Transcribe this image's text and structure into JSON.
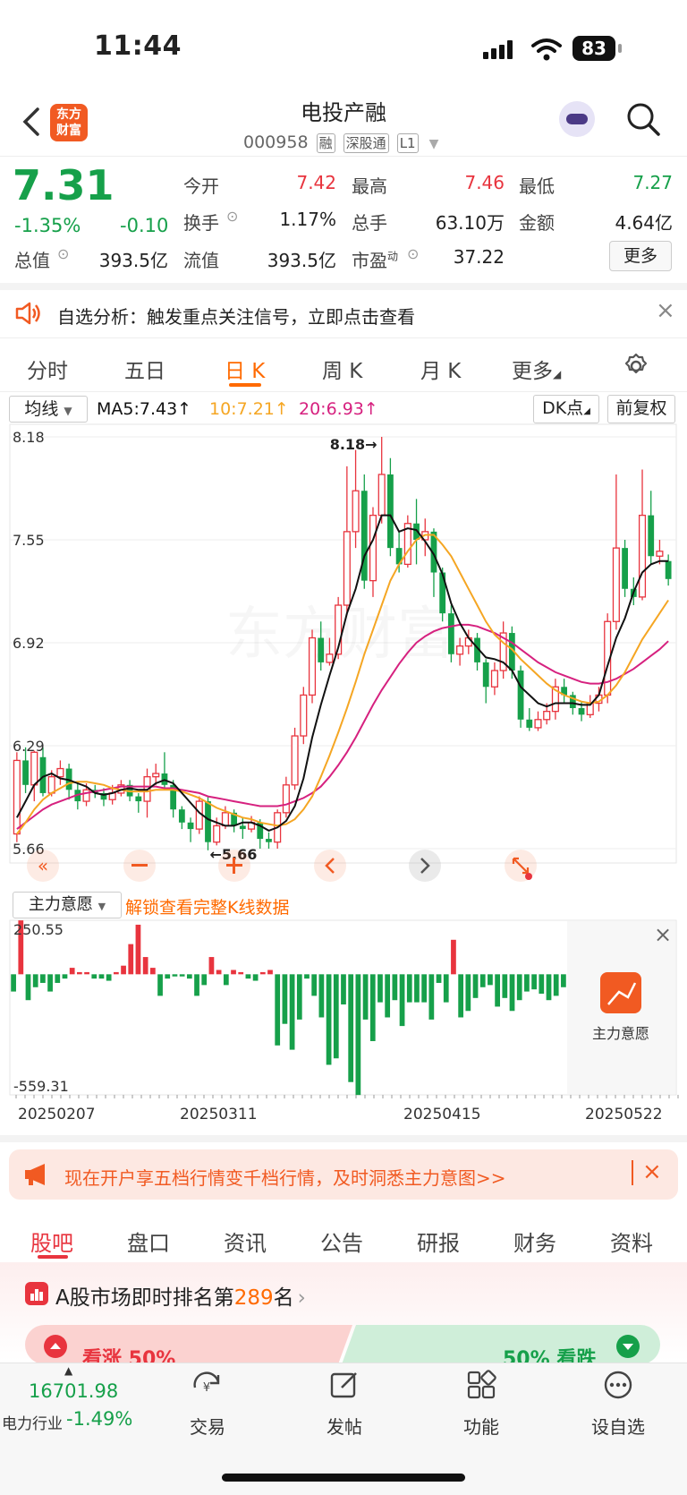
{
  "status_bar": {
    "time": "11:44",
    "battery": "83"
  },
  "header": {
    "back_icon": "chevron-left-icon",
    "logo_text_line1": "东方",
    "logo_text_line2": "财富",
    "title": "电投产融",
    "code": "000958",
    "tags": [
      "融",
      "深股通",
      "L1"
    ]
  },
  "quote": {
    "price": "7.31",
    "change_pct": "-1.35%",
    "change": "-0.10",
    "items": [
      {
        "label": "今开",
        "value": "7.42",
        "color": "red"
      },
      {
        "label": "最高",
        "value": "7.46",
        "color": "red"
      },
      {
        "label": "最低",
        "value": "7.27",
        "color": "green"
      },
      {
        "label": "换手",
        "value": "1.17%",
        "color": "dark"
      },
      {
        "label": "总手",
        "value": "63.10万",
        "color": "dark"
      },
      {
        "label": "金额",
        "value": "4.64亿",
        "color": "dark"
      },
      {
        "label": "总值",
        "value": "393.5亿",
        "color": "dark"
      },
      {
        "label": "流值",
        "value": "393.5亿",
        "color": "dark"
      },
      {
        "label": "市盈",
        "value": "37.22",
        "color": "dark"
      }
    ],
    "pe_superscript": "动",
    "more_label": "更多"
  },
  "notice": {
    "text": "自选分析：触发重点关注信号，立即点击查看"
  },
  "kline_tabs": [
    "分时",
    "五日",
    "日 K",
    "周 K",
    "月 K",
    "更多"
  ],
  "ma_bar": {
    "selector": "均线",
    "ma5": "MA5:7.43↑",
    "ma10": "10:7.21↑",
    "ma20": "20:6.93↑",
    "dk_label": "DK点",
    "adjust_label": "前复权"
  },
  "colors": {
    "up": "#e8343e",
    "down": "#16a04a",
    "ma5": "#111111",
    "ma10": "#f5a623",
    "ma20": "#d6217f",
    "accent": "#ff6a00"
  },
  "chart_data": [
    {
      "type": "candlestick",
      "y_ticks": [
        "8.18",
        "7.55",
        "6.92",
        "6.29",
        "5.66"
      ],
      "ylim": [
        5.66,
        8.18
      ],
      "max_label": "8.18→",
      "min_label": "←5.66",
      "watermark": "东方财富",
      "candles": [
        {
          "o": 5.75,
          "c": 6.2,
          "h": 6.25,
          "l": 5.7
        },
        {
          "o": 6.2,
          "c": 6.05,
          "h": 6.28,
          "l": 6.0
        },
        {
          "o": 6.05,
          "c": 6.25,
          "h": 6.26,
          "l": 5.95
        },
        {
          "o": 6.22,
          "c": 6.0,
          "h": 6.28,
          "l": 5.98
        },
        {
          "o": 6.0,
          "c": 6.1,
          "h": 6.14,
          "l": 5.98
        },
        {
          "o": 6.1,
          "c": 6.15,
          "h": 6.2,
          "l": 6.05
        },
        {
          "o": 6.15,
          "c": 6.02,
          "h": 6.18,
          "l": 5.96
        },
        {
          "o": 6.02,
          "c": 5.95,
          "h": 6.06,
          "l": 5.9
        },
        {
          "o": 5.95,
          "c": 6.02,
          "h": 6.06,
          "l": 5.92
        },
        {
          "o": 6.02,
          "c": 6.0,
          "h": 6.05,
          "l": 5.97
        },
        {
          "o": 6.0,
          "c": 5.96,
          "h": 6.03,
          "l": 5.92
        },
        {
          "o": 5.96,
          "c": 6.0,
          "h": 6.05,
          "l": 5.93
        },
        {
          "o": 6.0,
          "c": 6.05,
          "h": 6.08,
          "l": 5.98
        },
        {
          "o": 6.05,
          "c": 5.98,
          "h": 6.08,
          "l": 5.95
        },
        {
          "o": 5.98,
          "c": 5.95,
          "h": 6.0,
          "l": 5.88
        },
        {
          "o": 5.95,
          "c": 6.1,
          "h": 6.15,
          "l": 5.85
        },
        {
          "o": 6.1,
          "c": 6.12,
          "h": 6.18,
          "l": 6.05
        },
        {
          "o": 6.12,
          "c": 6.05,
          "h": 6.25,
          "l": 6.02
        },
        {
          "o": 6.05,
          "c": 5.9,
          "h": 6.08,
          "l": 5.85
        },
        {
          "o": 5.9,
          "c": 5.82,
          "h": 5.92,
          "l": 5.78
        },
        {
          "o": 5.82,
          "c": 5.78,
          "h": 5.85,
          "l": 5.7
        },
        {
          "o": 5.78,
          "c": 5.95,
          "h": 5.98,
          "l": 5.75
        },
        {
          "o": 5.95,
          "c": 5.7,
          "h": 5.98,
          "l": 5.65
        },
        {
          "o": 5.7,
          "c": 5.8,
          "h": 5.85,
          "l": 5.68
        },
        {
          "o": 5.8,
          "c": 5.88,
          "h": 5.92,
          "l": 5.78
        },
        {
          "o": 5.88,
          "c": 5.8,
          "h": 5.9,
          "l": 5.76
        },
        {
          "o": 5.8,
          "c": 5.78,
          "h": 5.85,
          "l": 5.72
        },
        {
          "o": 5.78,
          "c": 5.82,
          "h": 5.86,
          "l": 5.76
        },
        {
          "o": 5.82,
          "c": 5.72,
          "h": 5.84,
          "l": 5.66
        },
        {
          "o": 5.72,
          "c": 5.7,
          "h": 5.76,
          "l": 5.66
        },
        {
          "o": 5.7,
          "c": 5.88,
          "h": 5.9,
          "l": 5.66
        },
        {
          "o": 5.88,
          "c": 6.05,
          "h": 6.1,
          "l": 5.85
        },
        {
          "o": 6.05,
          "c": 6.35,
          "h": 6.4,
          "l": 6.02
        },
        {
          "o": 6.35,
          "c": 6.6,
          "h": 6.65,
          "l": 6.3
        },
        {
          "o": 6.6,
          "c": 6.95,
          "h": 7.0,
          "l": 6.55
        },
        {
          "o": 6.95,
          "c": 6.8,
          "h": 7.05,
          "l": 6.75
        },
        {
          "o": 6.8,
          "c": 6.85,
          "h": 6.95,
          "l": 6.78
        },
        {
          "o": 6.85,
          "c": 7.15,
          "h": 7.2,
          "l": 6.82
        },
        {
          "o": 7.15,
          "c": 7.6,
          "h": 8.0,
          "l": 7.1
        },
        {
          "o": 7.6,
          "c": 7.85,
          "h": 8.1,
          "l": 7.5
        },
        {
          "o": 7.85,
          "c": 7.3,
          "h": 7.95,
          "l": 7.25
        },
        {
          "o": 7.3,
          "c": 7.7,
          "h": 7.75,
          "l": 7.2
        },
        {
          "o": 7.7,
          "c": 7.95,
          "h": 8.18,
          "l": 7.65
        },
        {
          "o": 7.95,
          "c": 7.5,
          "h": 8.05,
          "l": 7.45
        },
        {
          "o": 7.5,
          "c": 7.4,
          "h": 7.6,
          "l": 7.35
        },
        {
          "o": 7.4,
          "c": 7.65,
          "h": 7.7,
          "l": 7.38
        },
        {
          "o": 7.65,
          "c": 7.55,
          "h": 7.8,
          "l": 7.4
        },
        {
          "o": 7.55,
          "c": 7.6,
          "h": 7.68,
          "l": 7.45
        },
        {
          "o": 7.6,
          "c": 7.35,
          "h": 7.62,
          "l": 7.2
        },
        {
          "o": 7.35,
          "c": 7.1,
          "h": 7.38,
          "l": 7.05
        },
        {
          "o": 7.1,
          "c": 6.85,
          "h": 7.15,
          "l": 6.8
        },
        {
          "o": 6.85,
          "c": 6.9,
          "h": 6.95,
          "l": 6.78
        },
        {
          "o": 6.9,
          "c": 6.95,
          "h": 7.0,
          "l": 6.85
        },
        {
          "o": 6.95,
          "c": 6.8,
          "h": 6.98,
          "l": 6.75
        },
        {
          "o": 6.8,
          "c": 6.65,
          "h": 6.82,
          "l": 6.55
        },
        {
          "o": 6.65,
          "c": 6.75,
          "h": 6.8,
          "l": 6.6
        },
        {
          "o": 6.75,
          "c": 6.98,
          "h": 7.05,
          "l": 6.7
        },
        {
          "o": 6.98,
          "c": 6.75,
          "h": 7.02,
          "l": 6.7
        },
        {
          "o": 6.75,
          "c": 6.45,
          "h": 6.78,
          "l": 6.4
        },
        {
          "o": 6.45,
          "c": 6.4,
          "h": 6.52,
          "l": 6.38
        },
        {
          "o": 6.4,
          "c": 6.45,
          "h": 6.5,
          "l": 6.38
        },
        {
          "o": 6.45,
          "c": 6.5,
          "h": 6.55,
          "l": 6.42
        },
        {
          "o": 6.5,
          "c": 6.65,
          "h": 6.7,
          "l": 6.45
        },
        {
          "o": 6.65,
          "c": 6.6,
          "h": 6.7,
          "l": 6.55
        },
        {
          "o": 6.6,
          "c": 6.52,
          "h": 6.62,
          "l": 6.48
        },
        {
          "o": 6.52,
          "c": 6.48,
          "h": 6.56,
          "l": 6.44
        },
        {
          "o": 6.48,
          "c": 6.55,
          "h": 6.6,
          "l": 6.46
        },
        {
          "o": 6.55,
          "c": 6.6,
          "h": 6.65,
          "l": 6.5
        },
        {
          "o": 6.6,
          "c": 7.05,
          "h": 7.1,
          "l": 6.55
        },
        {
          "o": 7.05,
          "c": 7.5,
          "h": 7.95,
          "l": 7.0
        },
        {
          "o": 7.5,
          "c": 7.25,
          "h": 7.55,
          "l": 7.2
        },
        {
          "o": 7.25,
          "c": 7.2,
          "h": 7.32,
          "l": 7.15
        },
        {
          "o": 7.2,
          "c": 7.7,
          "h": 7.98,
          "l": 7.18
        },
        {
          "o": 7.7,
          "c": 7.45,
          "h": 7.85,
          "l": 7.4
        },
        {
          "o": 7.45,
          "c": 7.48,
          "h": 7.55,
          "l": 7.4
        },
        {
          "o": 7.42,
          "c": 7.31,
          "h": 7.46,
          "l": 7.27
        }
      ],
      "ma5": [
        5.85,
        5.95,
        6.05,
        6.1,
        6.12,
        6.09,
        6.08,
        6.06,
        6.04,
        6.0,
        5.99,
        6.0,
        6.02,
        6.03,
        6.02,
        6.02,
        6.06,
        6.08,
        6.06,
        6.0,
        5.94,
        5.88,
        5.84,
        5.82,
        5.8,
        5.8,
        5.82,
        5.82,
        5.8,
        5.77,
        5.79,
        5.83,
        5.92,
        6.09,
        6.34,
        6.54,
        6.72,
        6.89,
        7.1,
        7.25,
        7.45,
        7.55,
        7.7,
        7.7,
        7.6,
        7.62,
        7.61,
        7.54,
        7.46,
        7.34,
        7.16,
        7.04,
        6.95,
        6.89,
        6.83,
        6.82,
        6.8,
        6.75,
        6.65,
        6.6,
        6.55,
        6.53,
        6.55,
        6.55,
        6.55,
        6.54,
        6.54,
        6.6,
        6.78,
        6.95,
        7.07,
        7.23,
        7.35,
        7.4,
        7.42,
        7.42
      ],
      "ma10": [
        5.75,
        5.82,
        5.9,
        5.96,
        6.0,
        6.03,
        6.06,
        6.07,
        6.07,
        6.06,
        6.05,
        6.03,
        6.02,
        6.01,
        6.01,
        6.01,
        6.02,
        6.02,
        6.02,
        6.01,
        5.99,
        5.97,
        5.94,
        5.91,
        5.89,
        5.87,
        5.85,
        5.84,
        5.82,
        5.81,
        5.8,
        5.81,
        5.84,
        5.9,
        5.98,
        6.1,
        6.23,
        6.37,
        6.52,
        6.68,
        6.85,
        7.0,
        7.15,
        7.3,
        7.4,
        7.48,
        7.55,
        7.58,
        7.58,
        7.52,
        7.45,
        7.35,
        7.25,
        7.15,
        7.05,
        6.97,
        6.92,
        6.88,
        6.82,
        6.77,
        6.72,
        6.67,
        6.63,
        6.6,
        6.58,
        6.56,
        6.55,
        6.56,
        6.6,
        6.66,
        6.74,
        6.84,
        6.94,
        7.02,
        7.1,
        7.18
      ],
      "ma20": [
        5.78,
        5.82,
        5.86,
        5.9,
        5.93,
        5.95,
        5.97,
        5.99,
        6.0,
        6.01,
        6.02,
        6.03,
        6.04,
        6.04,
        6.04,
        6.04,
        6.04,
        6.03,
        6.03,
        6.02,
        6.01,
        6.0,
        5.98,
        5.97,
        5.96,
        5.95,
        5.94,
        5.93,
        5.92,
        5.92,
        5.92,
        5.93,
        5.95,
        5.97,
        6.0,
        6.04,
        6.1,
        6.17,
        6.25,
        6.34,
        6.44,
        6.54,
        6.63,
        6.71,
        6.79,
        6.86,
        6.92,
        6.96,
        6.99,
        7.01,
        7.02,
        7.03,
        7.03,
        7.02,
        7.0,
        6.98,
        6.95,
        6.92,
        6.88,
        6.84,
        6.8,
        6.77,
        6.74,
        6.72,
        6.7,
        6.68,
        6.67,
        6.67,
        6.68,
        6.7,
        6.73,
        6.76,
        6.8,
        6.84,
        6.88,
        6.93
      ]
    },
    {
      "type": "bar",
      "title": "主力意愿",
      "y_ticks": [
        "250.55",
        "-559.31"
      ],
      "ylim": [
        -559.31,
        250.55
      ],
      "x_tick_labels": [
        "20250207",
        "20250311",
        "20250415",
        "20250522"
      ],
      "values": [
        -80,
        250,
        -120,
        -60,
        -40,
        -80,
        -40,
        -20,
        30,
        10,
        10,
        -20,
        -20,
        -30,
        10,
        40,
        140,
        230,
        80,
        30,
        -100,
        -20,
        -10,
        -10,
        -20,
        -100,
        -50,
        80,
        20,
        -50,
        20,
        10,
        -20,
        -30,
        10,
        20,
        -330,
        -230,
        -350,
        -210,
        -20,
        -100,
        -200,
        -420,
        -390,
        -140,
        -500,
        -560,
        -210,
        -310,
        -130,
        -200,
        -120,
        -240,
        -130,
        -130,
        -130,
        -210,
        -40,
        -130,
        160,
        -200,
        -170,
        -110,
        -60,
        -50,
        -150,
        -110,
        -170,
        -120,
        -80,
        -70,
        -90,
        -120,
        -100,
        -60
      ],
      "unlock_label": "解锁查看完整K线数据",
      "side_label": "主力意愿"
    }
  ],
  "ad": {
    "text": "现在开户享五档行情变千档行情，及时洞悉主力意图>>"
  },
  "bottom_tabs": [
    "股吧",
    "盘口",
    "资讯",
    "公告",
    "研报",
    "财务",
    "资料"
  ],
  "rank": {
    "prefix": "A股市场即时排名第",
    "number": "289",
    "suffix": "名",
    "bull": "看涨 50%",
    "bear": "50% 看跌"
  },
  "bottom_nav": {
    "index_value": "16701.98",
    "index_name": "电力行业",
    "index_change": "-1.49%",
    "items": [
      "交易",
      "发帖",
      "功能",
      "设自选"
    ]
  }
}
